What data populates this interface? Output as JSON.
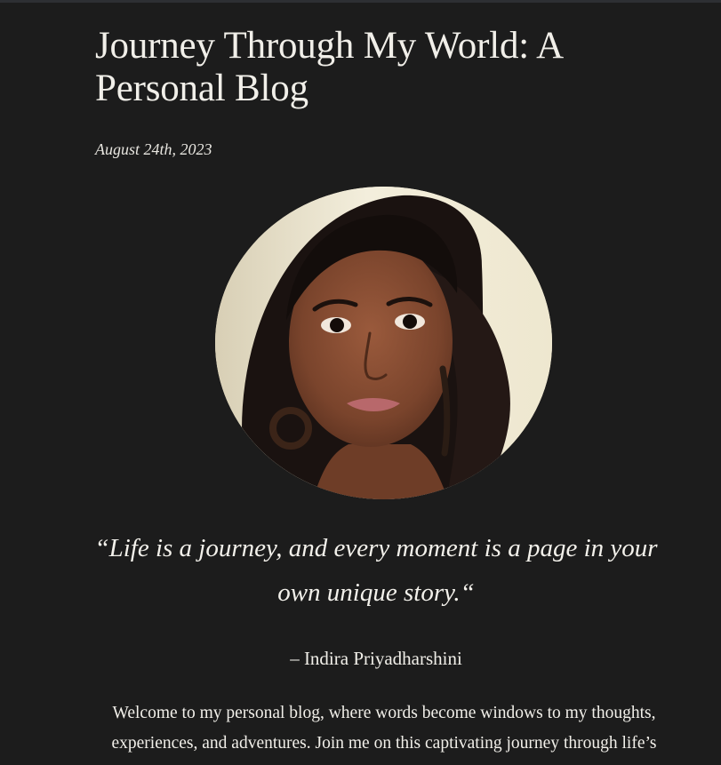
{
  "post": {
    "title": "Journey Through My World: A Personal Blog",
    "date": "August 24th, 2023",
    "quote": "“Life is a journey, and every moment is a page in your own unique story.“",
    "attribution": "– Indira Priyadharshini",
    "intro": "Welcome to my personal blog, where words become windows to my thoughts, experiences, and adventures. Join me on this captivating journey through life’s ups and downs as I share insightful stories and reflections along the way."
  },
  "images": {
    "portrait_icon": "person-portrait"
  },
  "colors": {
    "page_background": "#1c1c1c",
    "text": "#f1efe9",
    "top_strip": "#2d2f33"
  }
}
